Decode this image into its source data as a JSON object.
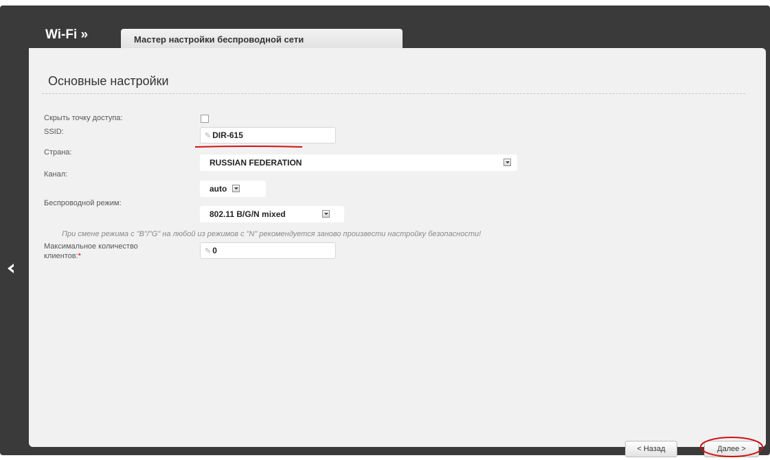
{
  "header": {
    "section": "Wi-Fi »",
    "tab": "Мастер настройки беспроводной сети"
  },
  "main": {
    "title": "Основные настройки",
    "fields": {
      "hide_ap": {
        "label": "Скрыть точку доступа:",
        "checked": false
      },
      "ssid": {
        "label": "SSID:",
        "value": "DIR-615"
      },
      "country": {
        "label": "Страна:",
        "value": "RUSSIAN FEDERATION"
      },
      "channel": {
        "label": "Канал:",
        "value": "auto"
      },
      "mode": {
        "label": "Беспроводной режим:",
        "value": "802.11 B/G/N mixed"
      },
      "max_clients": {
        "label": "Максимальное количество клиентов:",
        "value": "0",
        "required_mark": "*"
      }
    },
    "hint": "При смене режима с \"B\"/\"G\" на любой из режимов с \"N\" рекомендуется заново произвести настройку безопасности!"
  },
  "buttons": {
    "back": "< Назад",
    "next": "Далее >"
  },
  "icons": {
    "nav_back": "chevron-left-icon",
    "edit": "pencil-icon",
    "dropdown": "chevron-down-icon"
  },
  "colors": {
    "frame": "#3a3a3a",
    "panel": "#f1f1f1",
    "annotation": "#d01010"
  }
}
